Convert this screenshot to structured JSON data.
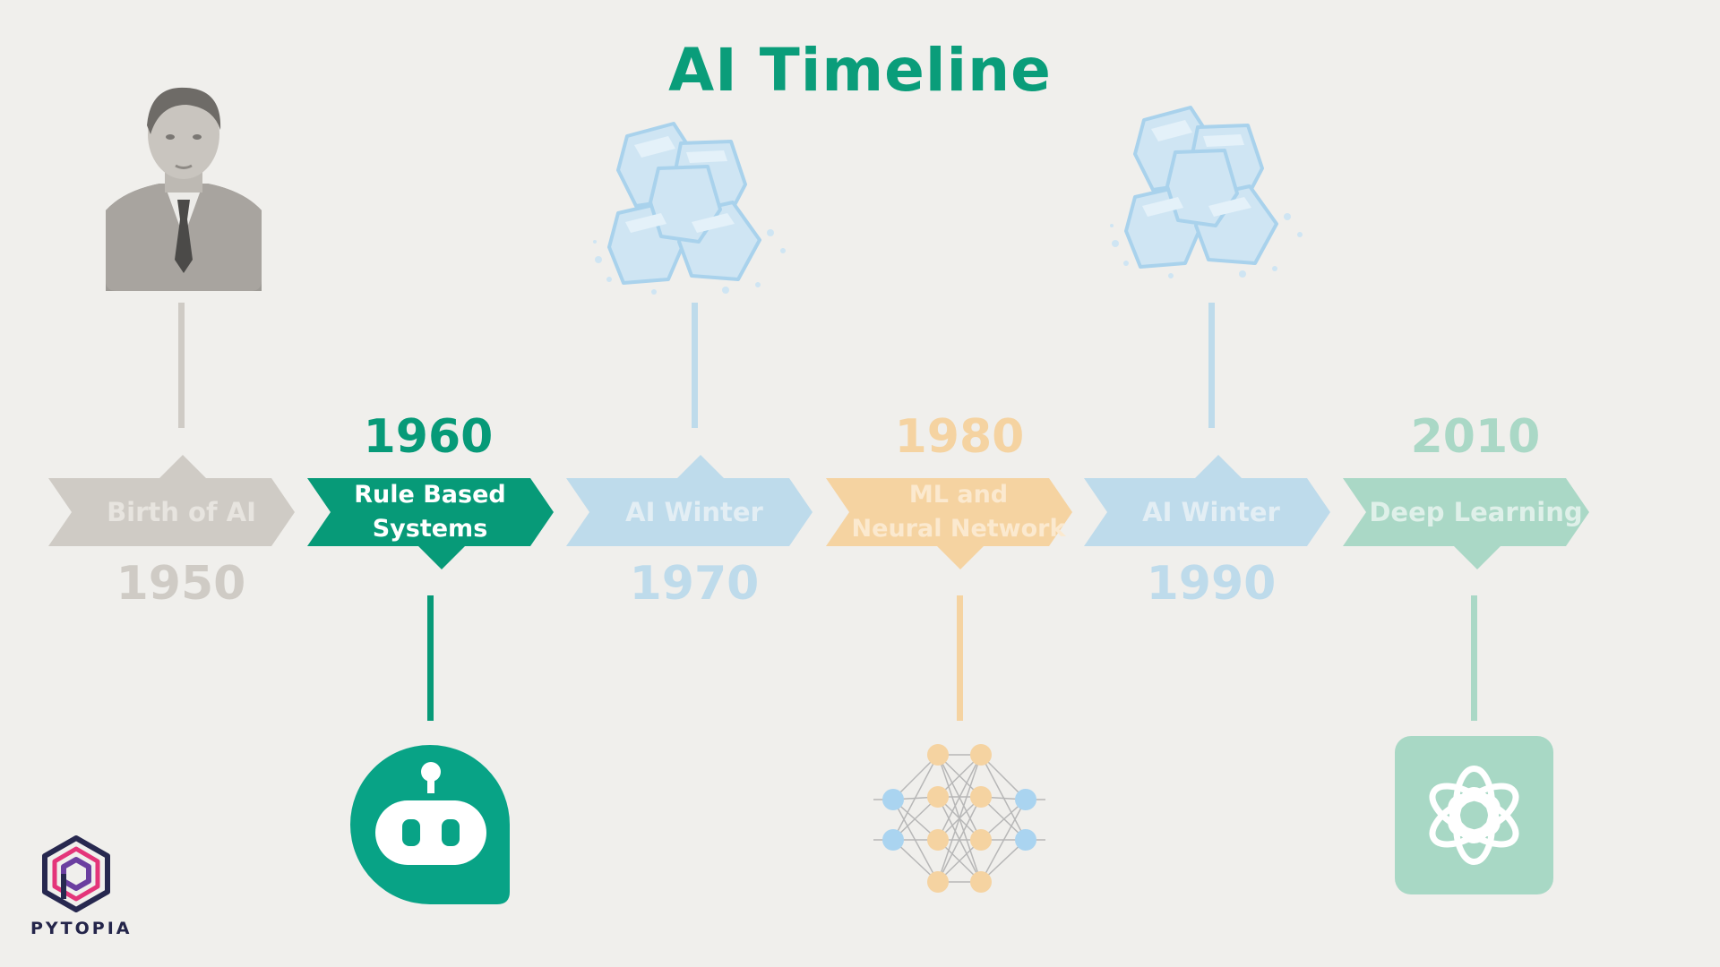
{
  "title": "AI Timeline",
  "events": [
    {
      "year": "1950",
      "label": "Birth of AI",
      "color": "#cfcbc5",
      "year_color": "#cfcbc5",
      "icon": "portrait-photo-icon"
    },
    {
      "year": "1960",
      "label": "Rule Based\nSystems",
      "color": "#079a78",
      "year_color": "#079a78",
      "icon": "robot-chat-icon"
    },
    {
      "year": "1970",
      "label": "AI Winter",
      "color": "#bedbeb",
      "year_color": "#bedbeb",
      "icon": "ice-cubes-icon"
    },
    {
      "year": "1980",
      "label": "ML and\nNeural Network",
      "color": "#f5d3a1",
      "year_color": "#f5d3a1",
      "icon": "neural-network-icon"
    },
    {
      "year": "1990",
      "label": "AI Winter",
      "color": "#bedbeb",
      "year_color": "#bedbeb",
      "icon": "ice-cubes-icon"
    },
    {
      "year": "2010",
      "label": "Deep Learning",
      "color": "#aad8c6",
      "year_color": "#aad8c6",
      "icon": "openai-logo-icon"
    }
  ],
  "brand": {
    "name": "PYTOPIA",
    "icon": "pytopia-hexagon-logo-icon"
  }
}
